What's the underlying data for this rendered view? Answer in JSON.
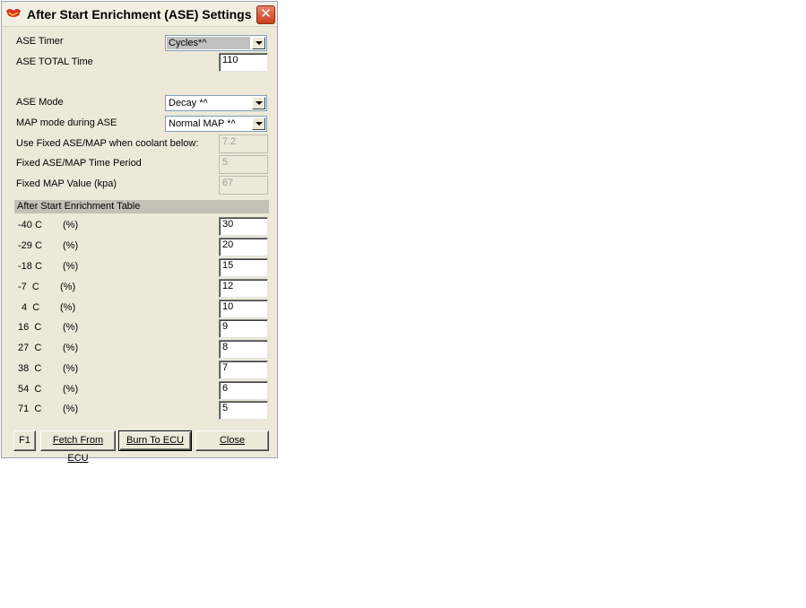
{
  "window": {
    "title": "After Start Enrichment (ASE) Settings",
    "close_glyph": "✕"
  },
  "settings": {
    "ase_timer": {
      "label": "ASE Timer",
      "value": "Cycles*^"
    },
    "ase_total_time": {
      "label": "ASE TOTAL Time",
      "value": "110"
    },
    "ase_mode": {
      "label": "ASE Mode",
      "value": "Decay *^"
    },
    "map_mode": {
      "label": "MAP mode during ASE",
      "value": "Normal MAP *^"
    },
    "fixed_coolant": {
      "label": "Use Fixed ASE/MAP when coolant below:",
      "value": "7.2"
    },
    "fixed_time": {
      "label": "Fixed ASE/MAP Time Period",
      "value": "5"
    },
    "fixed_map": {
      "label": "Fixed MAP Value (kpa)",
      "value": "67"
    }
  },
  "table": {
    "header": "After Start Enrichment Table",
    "rows": [
      {
        "temp": "-40 C",
        "unit": "(%)",
        "value": "30"
      },
      {
        "temp": "-29 C",
        "unit": "(%)",
        "value": "20"
      },
      {
        "temp": "-18 C",
        "unit": "(%)",
        "value": "15"
      },
      {
        "temp": "-7  C",
        "unit": "(%)",
        "value": "12"
      },
      {
        "temp": "4  C",
        "unit": "(%)",
        "value": "10"
      },
      {
        "temp": "16  C",
        "unit": "(%)",
        "value": "9"
      },
      {
        "temp": "27  C",
        "unit": "(%)",
        "value": "8"
      },
      {
        "temp": "38  C",
        "unit": "(%)",
        "value": "7"
      },
      {
        "temp": "54  C",
        "unit": "(%)",
        "value": "6"
      },
      {
        "temp": "71  C",
        "unit": "(%)",
        "value": "5"
      }
    ]
  },
  "buttons": {
    "f1": "F1",
    "fetch": "Fetch From ECU",
    "burn": "Burn To ECU",
    "close": "Close"
  }
}
